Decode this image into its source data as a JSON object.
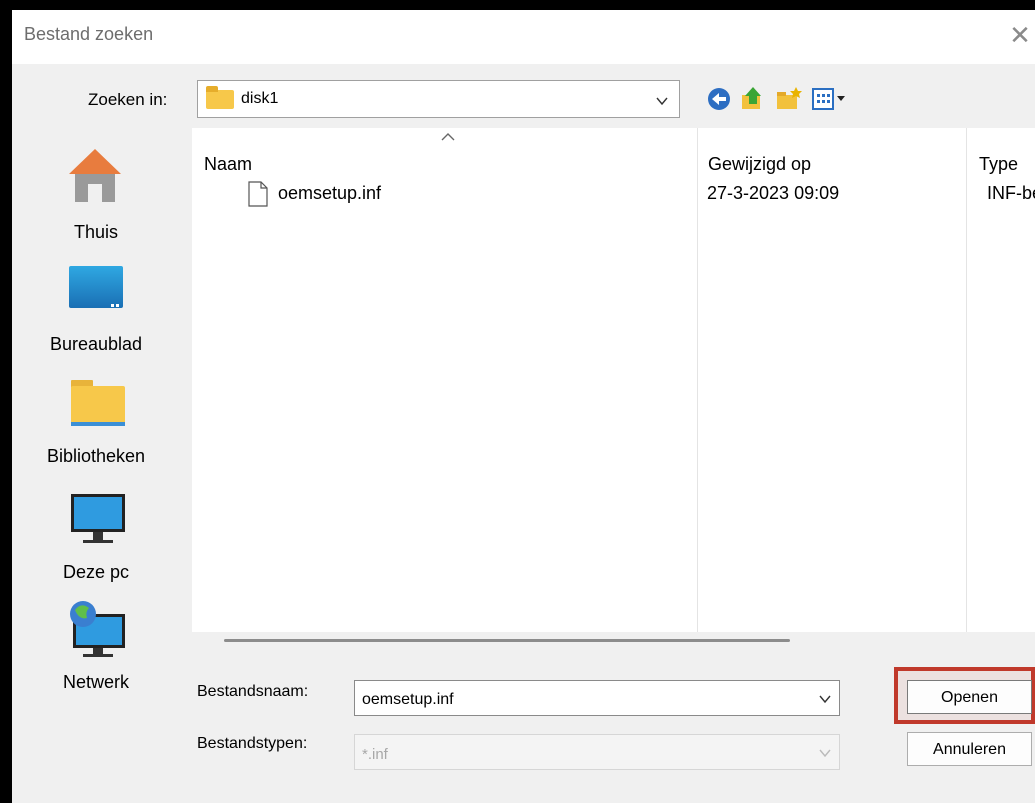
{
  "window": {
    "title": "Bestand zoeken"
  },
  "lookin": {
    "label": "Zoeken in:",
    "value": "disk1"
  },
  "toolbar": {
    "icons": [
      "back-icon",
      "up-folder-icon",
      "new-folder-icon",
      "view-menu-icon"
    ]
  },
  "places": [
    {
      "label": "Thuis",
      "icon": "home-icon"
    },
    {
      "label": "Bureaublad",
      "icon": "desktop-icon"
    },
    {
      "label": "Bibliotheken",
      "icon": "libraries-folder-icon"
    },
    {
      "label": "Deze pc",
      "icon": "computer-icon"
    },
    {
      "label": "Netwerk",
      "icon": "network-icon"
    }
  ],
  "filelist": {
    "columns": [
      "Naam",
      "Gewijzigd op",
      "Type"
    ],
    "rows": [
      {
        "name": "oemsetup.inf",
        "modified": "27-3-2023 09:09",
        "type": "INF-bestand"
      }
    ]
  },
  "filename": {
    "label": "Bestandsnaam:",
    "value": "oemsetup.inf"
  },
  "filetype": {
    "label": "Bestandstypen:",
    "value": "*.inf"
  },
  "buttons": {
    "open": "Openen",
    "cancel": "Annuleren"
  },
  "colors": {
    "highlight": "#c0392b",
    "folder": "#f7c84a"
  }
}
